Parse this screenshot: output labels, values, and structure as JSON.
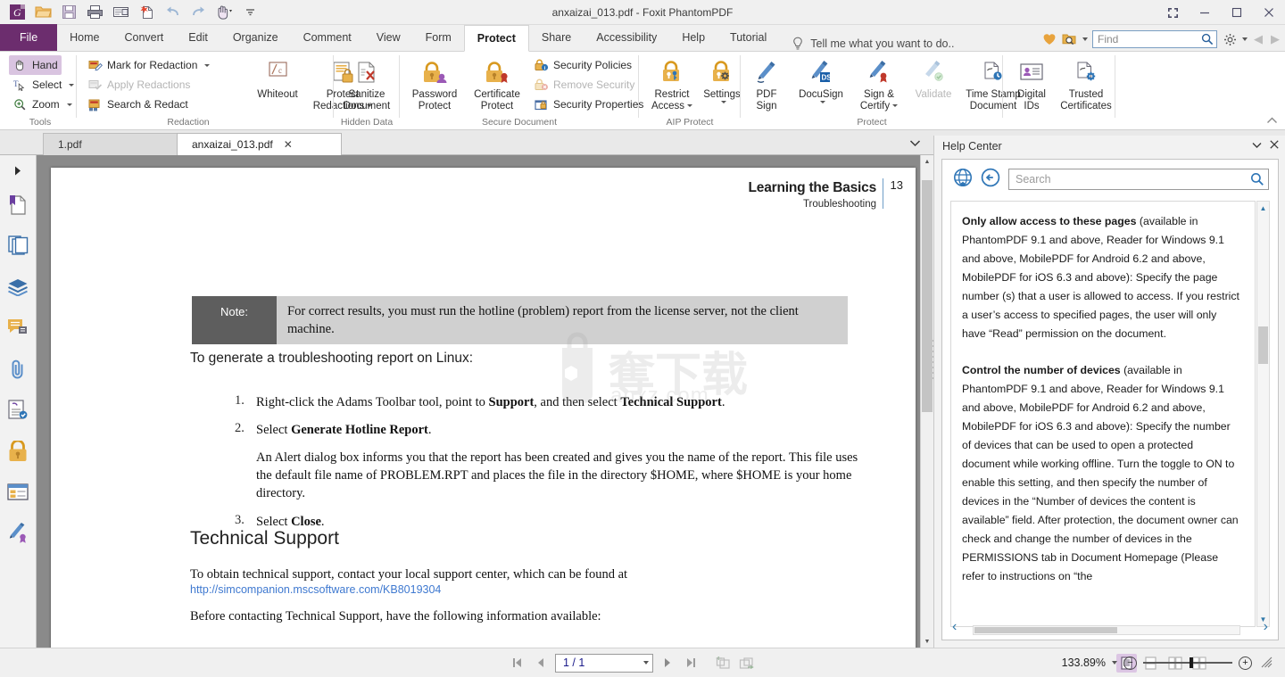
{
  "window": {
    "title": "anxaizai_013.pdf - Foxit PhantomPDF",
    "restore_label": "❐",
    "minimize_label": "–",
    "maximize_label": "❐",
    "close_label": "✕"
  },
  "quick_access": [
    {
      "name": "foxit-logo-icon",
      "label": "G"
    },
    {
      "name": "open-icon",
      "label": "Open"
    },
    {
      "name": "save-icon",
      "label": "Save"
    },
    {
      "name": "print-icon",
      "label": "Print"
    },
    {
      "name": "email-icon",
      "label": "Email"
    },
    {
      "name": "new-from-scan-icon",
      "label": "New"
    },
    {
      "name": "undo-icon",
      "label": "Undo"
    },
    {
      "name": "redo-icon",
      "label": "Redo"
    },
    {
      "name": "hand-tool-icon",
      "label": "Hand"
    },
    {
      "name": "customize-qat-icon",
      "label": "More"
    }
  ],
  "ribbon_tabs": [
    {
      "label": "File",
      "active": false,
      "file": true
    },
    {
      "label": "Home",
      "active": false
    },
    {
      "label": "Convert",
      "active": false
    },
    {
      "label": "Edit",
      "active": false
    },
    {
      "label": "Organize",
      "active": false
    },
    {
      "label": "Comment",
      "active": false
    },
    {
      "label": "View",
      "active": false
    },
    {
      "label": "Form",
      "active": false
    },
    {
      "label": "Protect",
      "active": true
    },
    {
      "label": "Share",
      "active": false
    },
    {
      "label": "Accessibility",
      "active": false
    },
    {
      "label": "Help",
      "active": false
    },
    {
      "label": "Tutorial",
      "active": false
    }
  ],
  "tell_me": "Tell me what you want to do..",
  "find": {
    "placeholder": "Find"
  },
  "ribbon": {
    "groups": [
      {
        "name": "tools",
        "label": "Tools",
        "items": [
          {
            "label": "Hand",
            "icon": "hand-icon",
            "selected": true
          },
          {
            "label": "Select",
            "icon": "select-text-icon",
            "dropdown": true
          },
          {
            "label": "Zoom",
            "icon": "zoom-in-icon",
            "dropdown": true
          }
        ]
      },
      {
        "name": "redaction",
        "label": "Redaction",
        "items": [
          {
            "label": "Mark for Redaction",
            "icon": "mark-redaction-icon",
            "dropdown": true
          },
          {
            "label": "Apply Redactions",
            "icon": "apply-redactions-icon",
            "disabled": true
          },
          {
            "label": "Search & Redact",
            "icon": "search-redact-icon"
          }
        ],
        "big_items": [
          {
            "label": "Whiteout",
            "icon": "whiteout-icon"
          },
          {
            "label": "Protect\nRedactions",
            "icon": "protect-redactions-icon",
            "dropdown": true
          }
        ]
      },
      {
        "name": "hidden-data",
        "label": "Hidden Data",
        "big_items": [
          {
            "label": "Sanitize\nDocument",
            "icon": "sanitize-document-icon"
          }
        ]
      },
      {
        "name": "secure-document",
        "label": "Secure Document",
        "big_items": [
          {
            "label": "Password\nProtect",
            "icon": "password-protect-icon"
          },
          {
            "label": "Certificate\nProtect",
            "icon": "certificate-protect-icon"
          }
        ],
        "items": [
          {
            "label": "Security Policies",
            "icon": "security-policies-icon"
          },
          {
            "label": "Remove Security",
            "icon": "remove-security-icon",
            "disabled": true
          },
          {
            "label": "Security Properties",
            "icon": "security-properties-icon"
          }
        ]
      },
      {
        "name": "aip-protect",
        "label": "AIP Protect",
        "big_items": [
          {
            "label": "Restrict\nAccess",
            "icon": "restrict-access-icon",
            "dropdown": true
          },
          {
            "label": "Settings",
            "icon": "aip-settings-icon",
            "dropdown": true
          }
        ]
      },
      {
        "name": "protect",
        "label": "Protect",
        "big_items": [
          {
            "label": "PDF\nSign",
            "icon": "pdf-sign-icon"
          },
          {
            "label": "DocuSign",
            "icon": "docusign-icon",
            "dropdown": true
          },
          {
            "label": "Sign &\nCertify",
            "icon": "sign-certify-icon",
            "dropdown": true
          },
          {
            "label": "Validate",
            "icon": "validate-icon",
            "disabled": true
          },
          {
            "label": "Time Stamp\nDocument",
            "icon": "time-stamp-document-icon"
          }
        ]
      },
      {
        "name": "certificates",
        "label": "",
        "big_items": [
          {
            "label": "Digital\nIDs",
            "icon": "digital-ids-icon"
          },
          {
            "label": "Trusted\nCertificates",
            "icon": "trusted-certificates-icon"
          }
        ]
      }
    ]
  },
  "doc_tabs": [
    {
      "label": "1.pdf",
      "active": false,
      "closable": false
    },
    {
      "label": "anxaizai_013.pdf",
      "active": true,
      "closable": true
    }
  ],
  "rail_items": [
    {
      "name": "expand-panel-icon",
      "label": "Expand Navigation Panels"
    },
    {
      "name": "bookmarks-icon",
      "label": "Bookmarks"
    },
    {
      "name": "pages-icon",
      "label": "Page Thumbnails"
    },
    {
      "name": "layers-icon",
      "label": "Layers"
    },
    {
      "name": "comments-icon",
      "label": "Comments"
    },
    {
      "name": "attachments-icon",
      "label": "Attachments"
    },
    {
      "name": "accessibility-tags-icon",
      "label": "Accessibility Tags"
    },
    {
      "name": "security-icon",
      "label": "Security"
    },
    {
      "name": "fields-icon",
      "label": "Fields"
    },
    {
      "name": "digital-signatures-icon",
      "label": "Digital Signatures"
    }
  ],
  "document": {
    "header_title": "Learning the Basics",
    "header_subtitle": "Troubleshooting",
    "page_number": "13",
    "note_label": "Note:",
    "note_text": "For correct results, you must run the hotline (problem) report from the license server, not the client machine.",
    "intro": "To generate a troubleshooting report on Linux:",
    "steps": [
      {
        "num": "1.",
        "html": "Right-click the Adams Toolbar tool, point to <b>Support</b>, and then select <b>Technical Support</b>."
      },
      {
        "num": "2.",
        "html": "Select <b>Generate Hotline Report</b>."
      },
      {
        "num": "",
        "html": "An Alert dialog box informs you that the report has been created and gives you the name of the report. This file uses the default file name of PROBLEM.RPT and places the file in the directory $HOME, where $HOME is your home directory."
      },
      {
        "num": "3.",
        "html": "Select <b>Close</b>."
      }
    ],
    "section_heading": "Technical Support",
    "section_p1": "To obtain technical support, contact your local support center, which can be found at",
    "section_link": "http://simcompanion.mscsoftware.com/KB8019304",
    "section_p2": "Before contacting Technical Support, have the following information available:",
    "watermark_text": "anxz.com"
  },
  "help_center": {
    "title": "Help Center",
    "search_placeholder": "Search",
    "home_icon": "home-globe-icon",
    "back_icon": "back-arrow-icon",
    "paragraphs": [
      {
        "bold": "Only allow access to these pages",
        "rest": " (available in PhantomPDF 9.1 and above, Reader for Windows 9.1 and above, MobilePDF for Android 6.2 and above, MobilePDF for iOS 6.3 and above): Specify the page number (s) that a user is allowed to access. If you restrict a user’s access to specified pages, the user will only have “Read” permission on the document."
      },
      {
        "bold": "Control the number of devices",
        "rest": " (available in PhantomPDF 9.1 and above, Reader for Windows 9.1 and above, MobilePDF for Android 6.2 and above, MobilePDF for iOS 6.3 and above): Specify the number of devices that can be used to open a protected document while working offline. Turn the toggle to ON to enable this setting, and then specify the number of devices in the “Number of devices the content is available” field. After protection, the document owner can check and change the number of devices in the PERMISSIONS tab in Document Homepage (Please refer to instructions on “the"
      }
    ]
  },
  "statusbar": {
    "page_value": "1 / 1",
    "zoom_value": "133.89%",
    "view_modes": [
      {
        "name": "single-page-view",
        "selected": true
      },
      {
        "name": "continuous-scroll-view",
        "selected": false
      },
      {
        "name": "facing-view",
        "selected": false
      },
      {
        "name": "continuous-facing-view",
        "selected": false
      }
    ]
  },
  "colors": {
    "brand_purple": "#6c2d6e",
    "accent_gold": "#e8b14b",
    "accent_blue": "#2e75b6",
    "link_blue": "#3f79d0",
    "selected_tint": "#d9c4e0"
  }
}
